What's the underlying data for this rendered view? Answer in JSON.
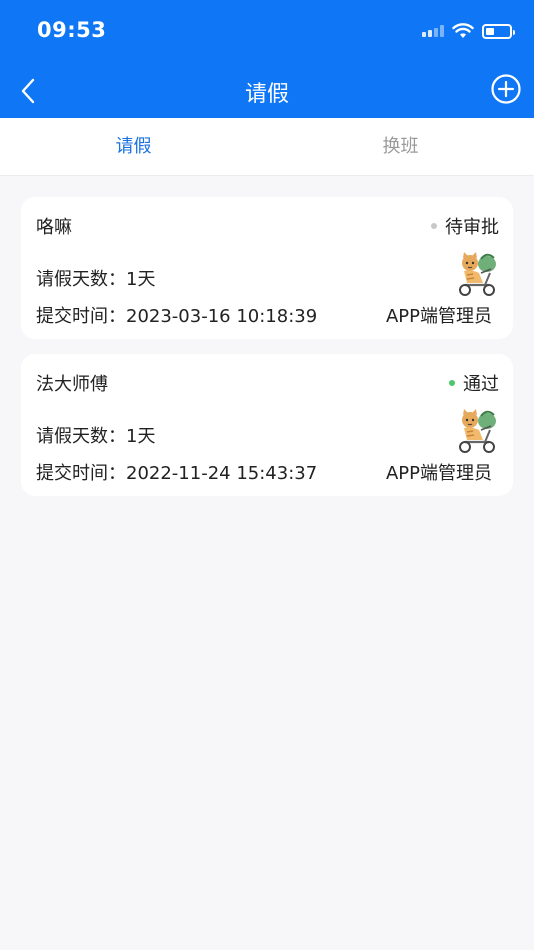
{
  "status_bar": {
    "time": "09:53"
  },
  "header": {
    "title": "请假"
  },
  "tabs": [
    {
      "label": "请假",
      "active": true
    },
    {
      "label": "换班",
      "active": false
    }
  ],
  "records": [
    {
      "name": "咯嘛",
      "status": "待审批",
      "status_color": "#c8c8c8",
      "days_label": "请假天数：",
      "days": "1天",
      "time_label": "提交时间：",
      "submit_time": "2023-03-16 10:18:39",
      "submitter": "APP端管理员"
    },
    {
      "name": "法大师傅",
      "status": "通过",
      "status_color": "#4cc76b",
      "days_label": "请假天数：",
      "days": "1天",
      "time_label": "提交时间：",
      "submit_time": "2022-11-24 15:43:37",
      "submitter": "APP端管理员"
    }
  ],
  "colors": {
    "primary": "#0f77f5",
    "tab_active": "#1a73e0",
    "background": "#f7f6f8"
  }
}
